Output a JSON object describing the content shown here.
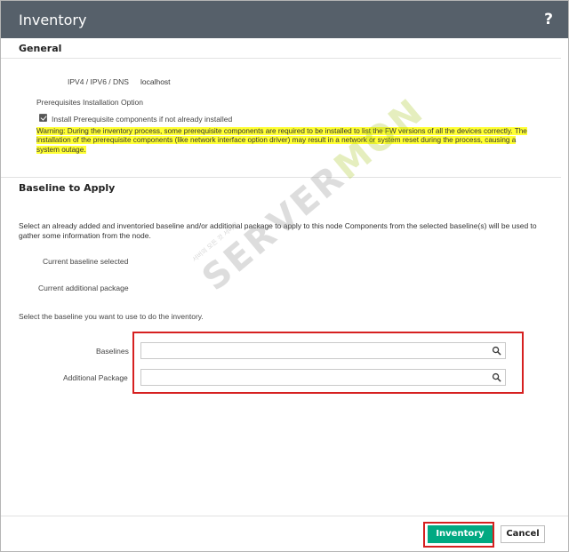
{
  "dialog": {
    "title": "Inventory",
    "help_icon_text": "?"
  },
  "general": {
    "title": "General",
    "host_label": "IPV4 / IPV6 / DNS",
    "host_value": "localhost",
    "prereq_option_label": "Prerequisites Installation Option",
    "prereq_checkbox_label": "Install Prerequisite components if not already installed",
    "prereq_checked": true,
    "warning": "Warning: During the inventory process, some prerequisite components are required to be installed to list the FW versions of all the devices correctly. The installation of the prerequisite components (like network interface option driver) may result in a network or system reset during the process, causing a system outage."
  },
  "baseline": {
    "title": "Baseline to Apply",
    "description": "Select an already added and inventoried baseline and/or additional package to apply to this node Components from the selected baseline(s) will be used to gather some information from the node.",
    "current_baseline_label": "Current baseline selected",
    "current_package_label": "Current additional package",
    "instruction": "Select the baseline you want to use to do the inventory.",
    "baselines_label": "Baselines",
    "baselines_value": "",
    "package_label": "Additional Package",
    "package_value": ""
  },
  "footer": {
    "primary_label": "Inventory",
    "cancel_label": "Cancel"
  },
  "watermark": {
    "text_a": "SERVER",
    "text_b": "MON",
    "sub": "서버의 모든 것 서버몬"
  },
  "colors": {
    "titlebar": "#56606a",
    "primary": "#01a982",
    "highlight": "#ffff33",
    "annotation": "#d62020"
  }
}
